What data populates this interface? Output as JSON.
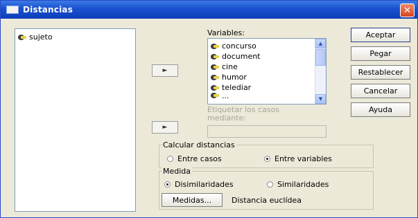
{
  "window": {
    "title": "Distancias",
    "close_glyph": "✕"
  },
  "source_list": {
    "items": [
      {
        "label": "sujeto"
      }
    ]
  },
  "arrow_label": "►",
  "variables": {
    "label": "Variables:",
    "items": [
      {
        "label": "concurso"
      },
      {
        "label": "document"
      },
      {
        "label": "cine"
      },
      {
        "label": "humor"
      },
      {
        "label": "telediar"
      },
      {
        "label": "..."
      }
    ]
  },
  "label_cases": {
    "label": "Etiquetar los casos mediante:"
  },
  "buttons": {
    "accept": "Aceptar",
    "paste": "Pegar",
    "reset": "Restablecer",
    "cancel": "Cancelar",
    "help": "Ayuda"
  },
  "calc_group": {
    "label": "Calcular distancias",
    "between_cases": "Entre casos",
    "between_vars": "Entre variables",
    "selected": "between_vars"
  },
  "measure_group": {
    "label": "Medida",
    "dissimilarities": "Disimilaridades",
    "similarities": "Similaridades",
    "selected": "dissimilarities",
    "measures_button": "Medidas...",
    "measure_value": "Distancia euclídea"
  }
}
